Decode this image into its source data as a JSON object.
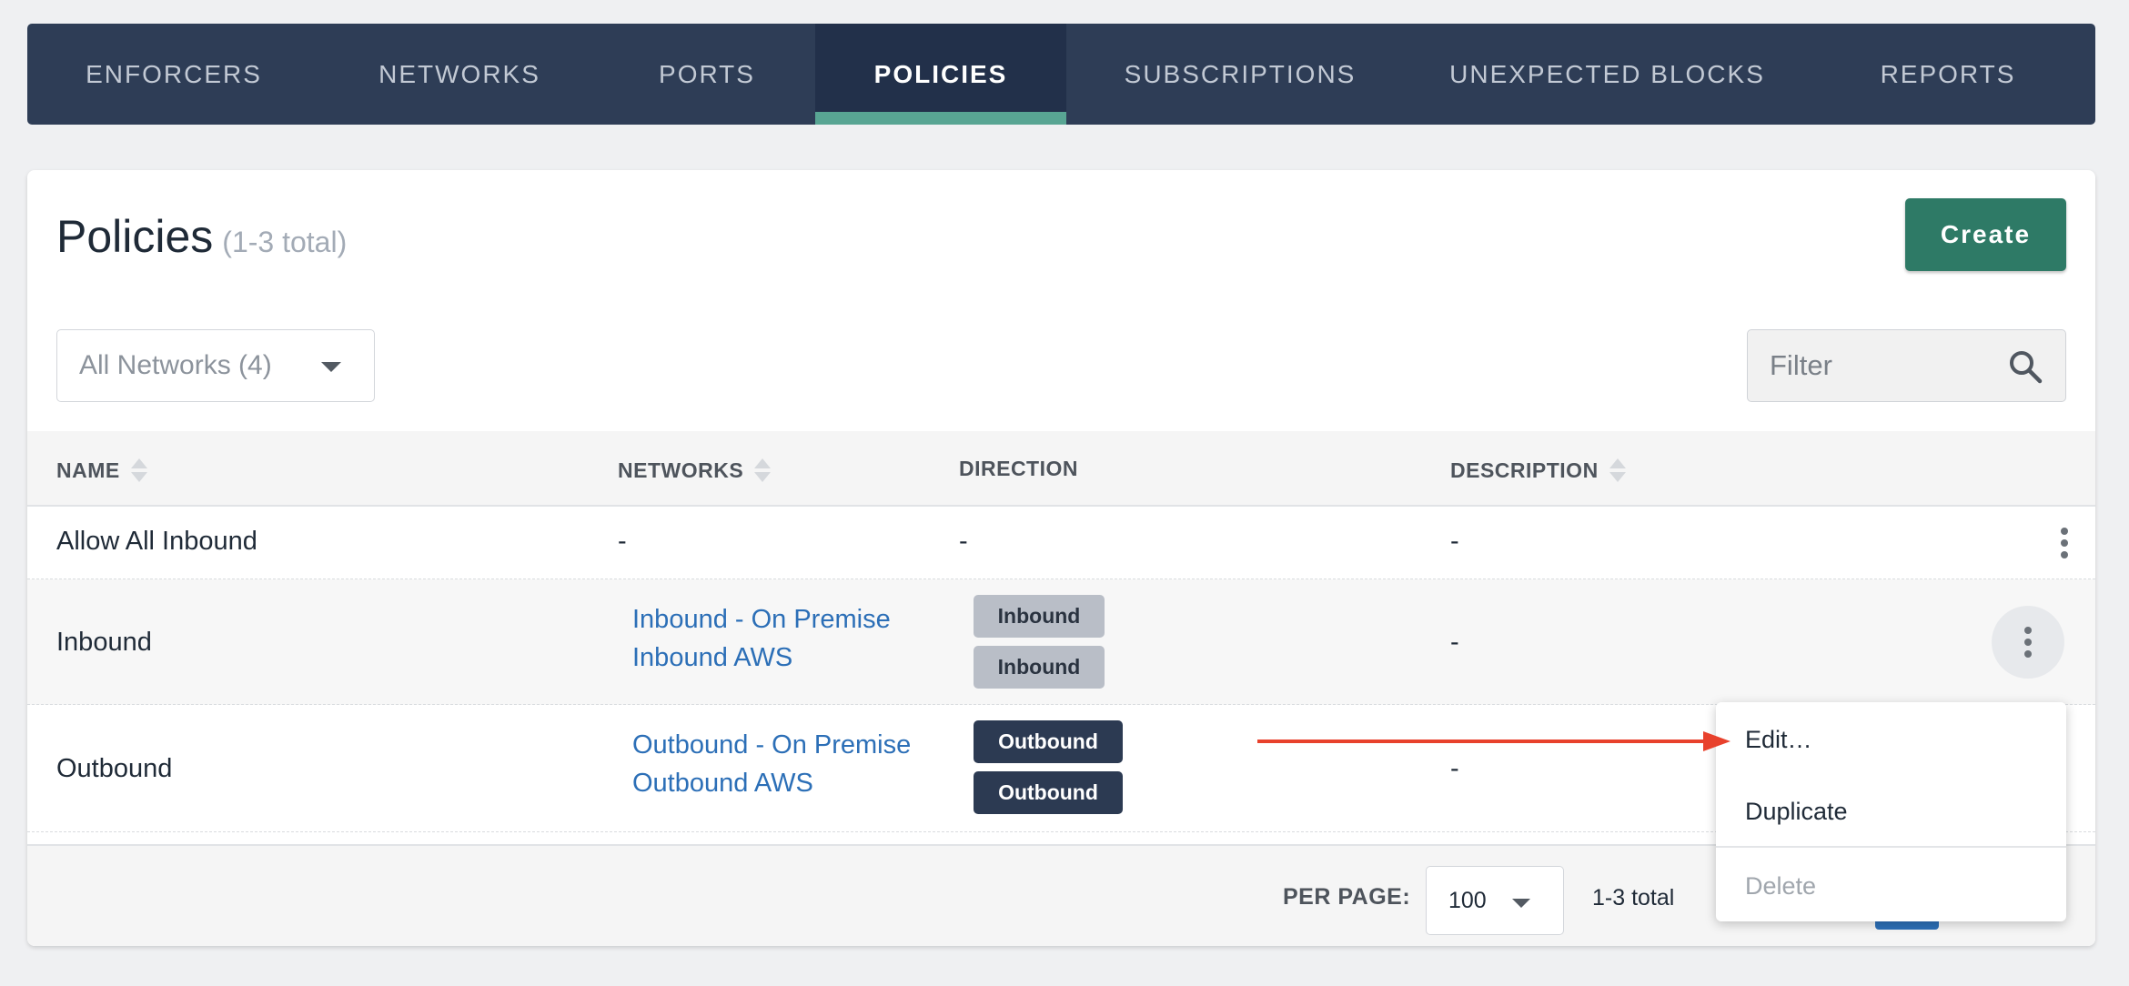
{
  "nav": {
    "tabs": [
      {
        "label": "ENFORCERS"
      },
      {
        "label": "NETWORKS"
      },
      {
        "label": "PORTS"
      },
      {
        "label": "POLICIES"
      },
      {
        "label": "SUBSCRIPTIONS"
      },
      {
        "label": "UNEXPECTED BLOCKS"
      },
      {
        "label": "REPORTS"
      }
    ],
    "active_tab": "POLICIES",
    "active_indicator_color": "#58a593"
  },
  "header": {
    "title": "Policies",
    "count": "(1-3 total)",
    "create_label": "Create",
    "create_color": "#2e7a66"
  },
  "toolbar": {
    "network_select": "All Networks (4)",
    "filter_placeholder": "Filter"
  },
  "table": {
    "columns": [
      "NAME",
      "NETWORKS",
      "DIRECTION",
      "DESCRIPTION"
    ],
    "rows": [
      {
        "name": "Allow All Inbound",
        "networks": [
          "-"
        ],
        "direction": [
          "-"
        ],
        "description": "-"
      },
      {
        "name": "Inbound",
        "networks": [
          "Inbound - On Premise",
          "Inbound AWS"
        ],
        "direction": [
          "Inbound",
          "Inbound"
        ],
        "description": "-"
      },
      {
        "name": "Outbound",
        "networks": [
          "Outbound - On Premise",
          "Outbound AWS"
        ],
        "direction": [
          "Outbound",
          "Outbound"
        ],
        "description": "-"
      }
    ]
  },
  "footer": {
    "per_page_label": "PER PAGE:",
    "per_page_value": "100",
    "total": "1-3 total"
  },
  "context_menu": {
    "items": [
      {
        "label": "Edit…",
        "enabled": true
      },
      {
        "label": "Duplicate",
        "enabled": true
      },
      {
        "label": "Delete",
        "enabled": false
      }
    ]
  },
  "annotation": {
    "arrow_color": "#e8412c"
  }
}
